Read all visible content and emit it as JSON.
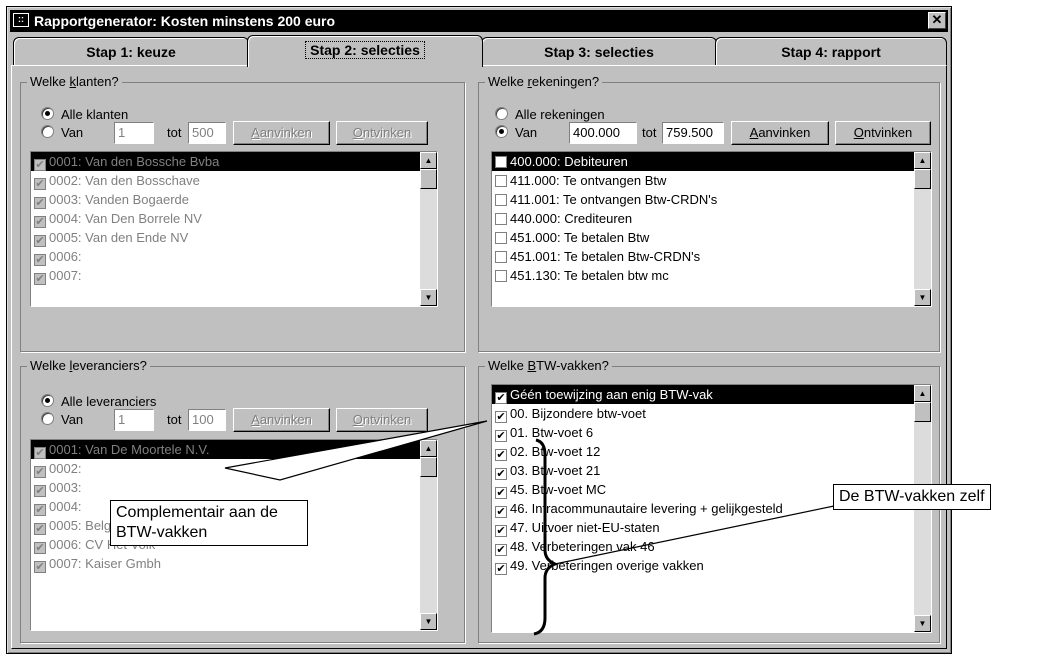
{
  "window": {
    "title": "Rapportgenerator: Kosten minstens 200 euro",
    "close_label": "✕",
    "sys_icon": "::"
  },
  "tabs": [
    {
      "label": "Stap 1: keuze"
    },
    {
      "label": "Stap 2: selecties"
    },
    {
      "label": "Stap 3: selecties"
    },
    {
      "label": "Stap 4: rapport"
    }
  ],
  "klanten": {
    "title_pre": "Welke ",
    "title_key": "k",
    "title_post": "lanten?",
    "radio_all": "Alle klanten",
    "radio_from": "Van",
    "from": "1",
    "to_label": "tot",
    "to": "500",
    "check_pre": "",
    "check_key": "A",
    "check_post": "anvinken",
    "uncheck_key": "O",
    "uncheck_post": "ntvinken",
    "items": [
      "0001:  Van den Bossche Bvba",
      "0002:  Van den Bosschave",
      "0003:  Vanden Bogaerde",
      "0004:  Van Den Borrele NV",
      "0005:  Van den Ende NV",
      "0006:",
      "0007:"
    ]
  },
  "rekeningen": {
    "title_pre": "Welke ",
    "title_key": "r",
    "title_post": "ekeningen?",
    "radio_all": "Alle rekeningen",
    "radio_from": "Van",
    "from": "400.000",
    "to_label": "tot",
    "to": "759.500",
    "check_key": "A",
    "check_post": "anvinken",
    "uncheck_key": "O",
    "uncheck_post": "ntvinken",
    "items": [
      "400.000:  Debiteuren",
      "411.000:  Te ontvangen Btw",
      "411.001:  Te ontvangen Btw-CRDN's",
      "440.000:  Crediteuren",
      "451.000:  Te betalen Btw",
      "451.001:  Te betalen Btw-CRDN's",
      "451.130:  Te betalen btw mc"
    ]
  },
  "leveranciers": {
    "title_pre": "Welke ",
    "title_key": "l",
    "title_post": "everanciers?",
    "radio_all": "Alle leveranciers",
    "radio_from": "Van",
    "from": "1",
    "to_label": "tot",
    "to": "100",
    "check_key": "A",
    "check_post": "anvinken",
    "uncheck_key": "O",
    "uncheck_post": "ntvinken",
    "items": [
      "0001:  Van De Moortele N.V.",
      "0002:",
      "0003:",
      "0004:",
      "0005:  Belgacom",
      "0006:  CV Het Volk",
      "0007:  Kaiser Gmbh"
    ]
  },
  "btw": {
    "title_pre": "Welke ",
    "title_key": "B",
    "title_post": "TW-vakken?",
    "items": [
      "Géén toewijzing aan enig BTW-vak",
      "00.  Bijzondere btw-voet",
      "01.  Btw-voet 6",
      "02.  Btw-voet 12",
      "03.  Btw-voet 21",
      "45.  Btw-voet MC",
      "46.  Intracommunautaire levering + gelijkgesteld",
      "47.  Uitvoer niet-EU-staten",
      "48.  Verbeteringen vak 46",
      "49.  Verbeteringen overige vakken"
    ]
  },
  "annotations": {
    "complement": "Complementair aan de BTW-vakken",
    "zelf": "De BTW-vakken zelf"
  },
  "icons": {
    "check": "✔",
    "scroll_up": "▲",
    "scroll_down": "▼"
  }
}
